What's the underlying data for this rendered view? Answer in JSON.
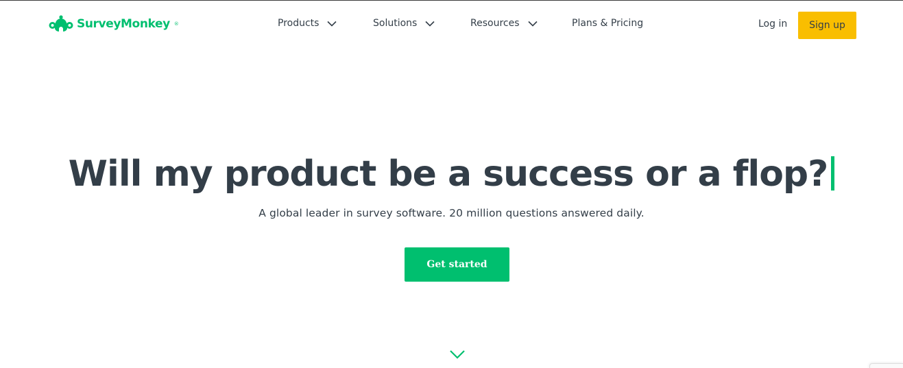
{
  "brand": {
    "name": "SurveyMonkey",
    "registered": "®",
    "color": "#00bf6f"
  },
  "nav": {
    "items": [
      {
        "label": "Products",
        "has_dropdown": true
      },
      {
        "label": "Solutions",
        "has_dropdown": true
      },
      {
        "label": "Resources",
        "has_dropdown": true
      },
      {
        "label": "Plans & Pricing",
        "has_dropdown": false
      }
    ],
    "login_label": "Log in",
    "signup_label": "Sign up",
    "signup_color": "#f9be00"
  },
  "hero": {
    "title": "Will my product be a success or a flop?",
    "subtitle": "A global leader in survey software. 20 million questions answered daily.",
    "cta_label": "Get started",
    "cta_color": "#00bf6f",
    "text_color": "#333e48"
  },
  "icons": {
    "logo": "monkey-logo-icon",
    "dropdown": "chevron-down-icon",
    "scroll": "chevron-down-icon"
  }
}
